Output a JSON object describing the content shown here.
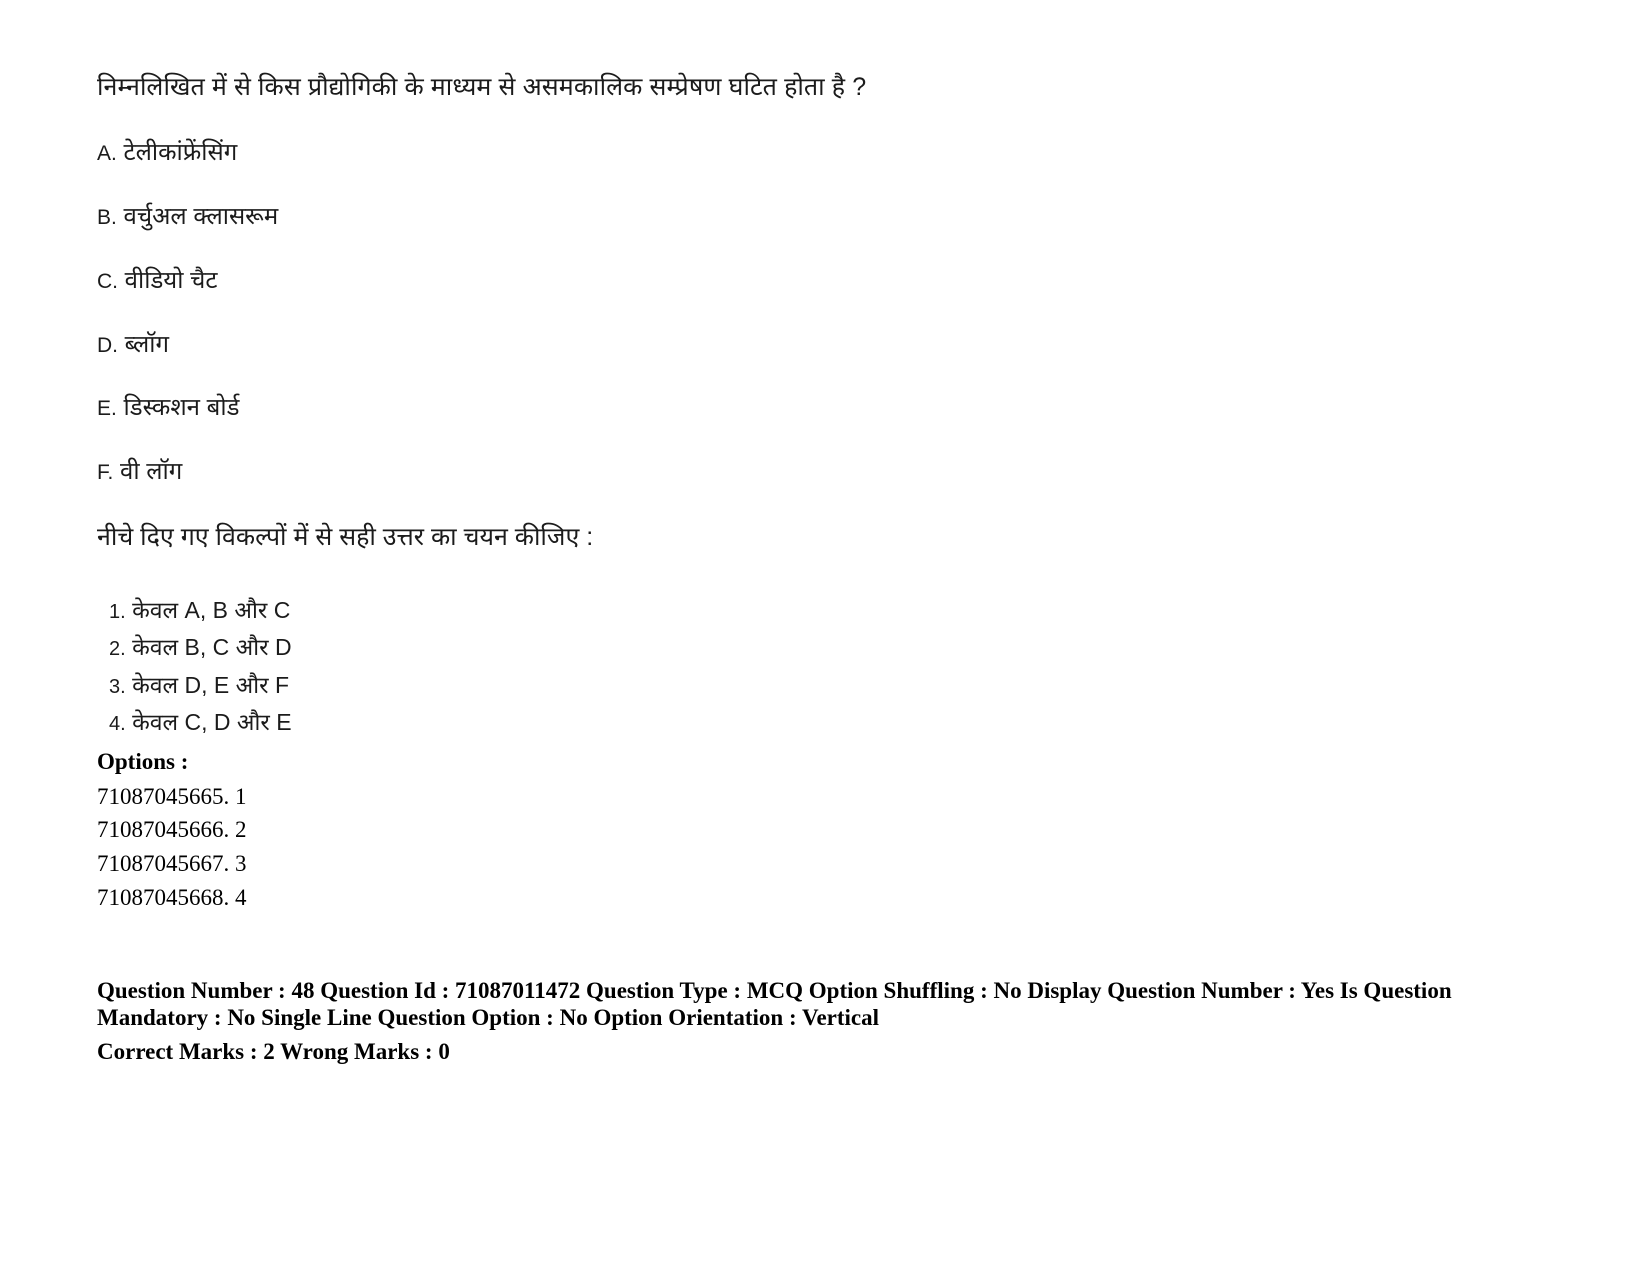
{
  "question": {
    "stem": "निम्नलिखित में से किस प्रौद्योगिकी के माध्यम से असमकालिक सम्प्रेषण घटित होता है ?",
    "statements": [
      {
        "label": "A.",
        "text": "टेलीकांफ्रेंसिंग"
      },
      {
        "label": "B.",
        "text": "वर्चुअल क्लासरूम"
      },
      {
        "label": "C.",
        "text": "वीडियो चैट"
      },
      {
        "label": "D.",
        "text": "ब्लॉग"
      },
      {
        "label": "E.",
        "text": "डिस्कशन बोर्ड"
      },
      {
        "label": "F.",
        "text": "वी लॉग"
      }
    ],
    "instruction": "नीचे दिए गए विकल्पों में से सही उत्तर का चयन कीजिए :",
    "choices": [
      {
        "num": "1.",
        "text": "केवल A, B और C"
      },
      {
        "num": "2.",
        "text": "केवल B, C और D"
      },
      {
        "num": "3.",
        "text": "केवल D, E और F"
      },
      {
        "num": "4.",
        "text": "केवल C, D और E"
      }
    ]
  },
  "options_block": {
    "heading": "Options :",
    "items": [
      "71087045665. 1",
      "71087045666. 2",
      "71087045667. 3",
      "71087045668. 4"
    ]
  },
  "meta": {
    "line1": "Question Number : 48 Question Id : 71087011472 Question Type : MCQ Option Shuffling : No Display Question Number : Yes Is Question Mandatory : No Single Line Question Option : No Option Orientation : Vertical",
    "line2": "Correct Marks : 2 Wrong Marks : 0"
  }
}
